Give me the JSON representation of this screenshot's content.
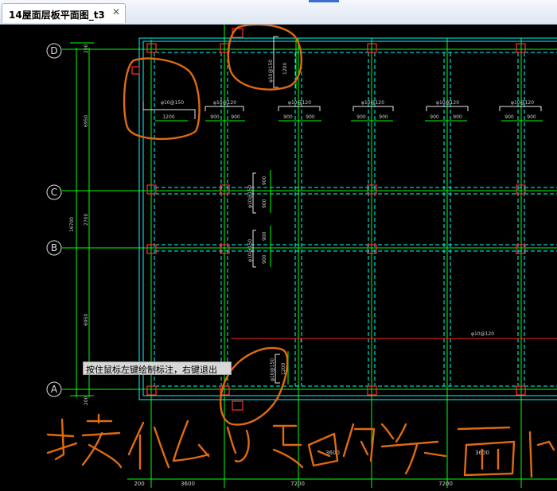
{
  "tab": {
    "title": "14屋面层板平面图_t3",
    "close_symbol": "✕"
  },
  "command_tooltip": "按住鼠标左键绘制标注，右键退出",
  "axes": {
    "rows": [
      "D",
      "C",
      "B",
      "A"
    ]
  },
  "dimensions": {
    "left_outer": "16700",
    "left_segments": [
      "6950",
      "2700",
      "6950"
    ],
    "left_edge_offsets": [
      "200",
      "200"
    ],
    "bottom": [
      "200",
      "3600",
      "3600",
      "7200",
      "3600",
      "7200"
    ]
  },
  "rebar_labels": {
    "top_row": [
      "φ10@150",
      "φ10@120",
      "φ10@120",
      "φ10@120",
      "φ10@120",
      "φ10@120"
    ],
    "top_row_dims": [
      [
        "1200"
      ],
      [
        "900",
        "900"
      ],
      [
        "900",
        "900"
      ],
      [
        "900",
        "900"
      ],
      [
        "900",
        "900"
      ],
      [
        "900",
        "900"
      ]
    ],
    "vertical_d": {
      "label": "φ10@150",
      "dim": "1200"
    },
    "vertical_mid_upper": {
      "label": "φ10@150",
      "dims": [
        "900",
        "900"
      ]
    },
    "vertical_mid_lower": {
      "label": "φ10@150",
      "dims": [
        "900",
        "900"
      ]
    },
    "vertical_a": {
      "label": "φ10@150",
      "dim": "1200"
    },
    "red_span": "φ10@120"
  },
  "colors": {
    "grid": "#00ff00",
    "slab": "#00ffff",
    "column": "#ff3030",
    "rebar": "#d8d8d8",
    "ink": "#e06a10"
  }
}
